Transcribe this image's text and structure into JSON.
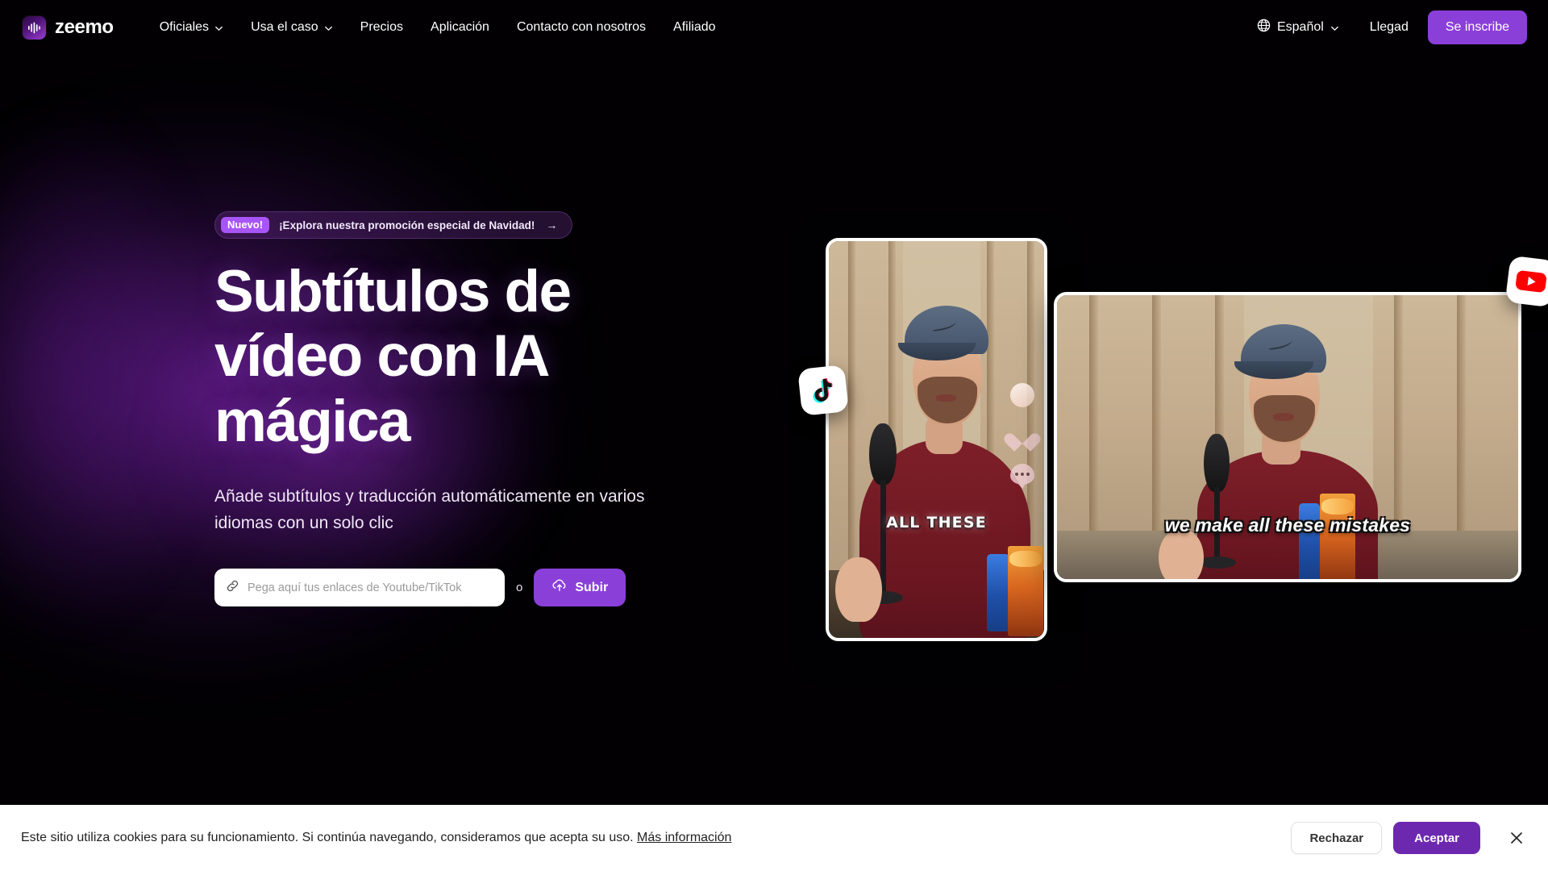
{
  "nav": {
    "brand": "zeemo",
    "brand_icon": "waveform-icon",
    "links": [
      {
        "label": "Oficiales",
        "has_dropdown": true
      },
      {
        "label": "Usa el caso",
        "has_dropdown": true
      },
      {
        "label": "Precios",
        "has_dropdown": false
      },
      {
        "label": "Aplicación",
        "has_dropdown": false
      },
      {
        "label": "Contacto con nosotros",
        "has_dropdown": false
      },
      {
        "label": "Afiliado",
        "has_dropdown": false
      }
    ],
    "language": {
      "icon": "globe-icon",
      "label": "Español",
      "chevron": "chevron-down-icon"
    },
    "login_label": "Llegad",
    "signup_label": "Se inscribe"
  },
  "hero": {
    "promo": {
      "tag": "Nuevo!",
      "text": "¡Explora nuestra promoción especial de Navidad!",
      "arrow": "→"
    },
    "title": "Subtítulos de vídeo con IA mágica",
    "subtitle": "Añade subtítulos y traducción automáticamente en varios idiomas con un solo clic",
    "url_input": {
      "placeholder": "Pega aquí tus enlaces de Youtube/TikTok",
      "value": "",
      "icon": "link-icon"
    },
    "separator": "o",
    "upload_label": "Subir",
    "upload_icon": "cloud-upload-icon"
  },
  "media": {
    "portrait_caption": "ALL THESE",
    "landscape_caption": "we make all these mistakes",
    "tiktok_badge": "tiktok-icon",
    "youtube_badge": "youtube-icon",
    "tiktok_ui": [
      "avatar-icon",
      "heart-icon",
      "comment-icon"
    ]
  },
  "cookie": {
    "text": "Este sitio utiliza cookies para su funcionamiento. Si continúa navegando, consideramos que acepta su uso.",
    "link": "Más información",
    "reject_label": "Rechazar",
    "accept_label": "Aceptar",
    "close_icon": "close-icon"
  },
  "colors": {
    "accent": "#8b3fd9",
    "accent_dark": "#6d28b0",
    "promo_tag": "#a855f7",
    "page_bg": "#020003"
  }
}
